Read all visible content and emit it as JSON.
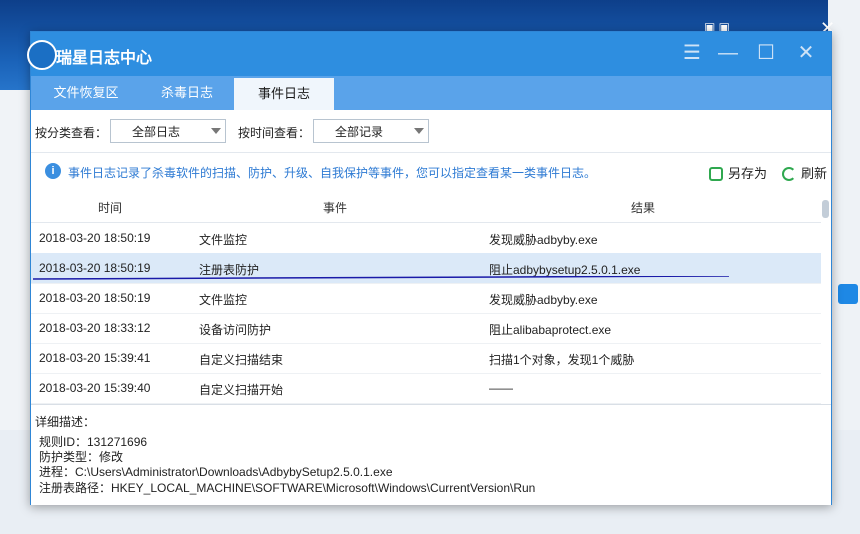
{
  "window": {
    "title": "瑞星日志中心",
    "controls": {
      "menu_icon": "menu-icon",
      "minimize_icon": "minimize-icon",
      "maximize_icon": "maximize-icon",
      "close_icon": "close-icon"
    }
  },
  "tabs": [
    {
      "label": "文件恢复区",
      "active": false
    },
    {
      "label": "杀毒日志",
      "active": false
    },
    {
      "label": "事件日志",
      "active": true
    }
  ],
  "filters": {
    "category_label": "按分类查看：",
    "category_value": "全部日志",
    "time_label": "按时间查看：",
    "time_value": "全部记录"
  },
  "info": {
    "text": "事件日志记录了杀毒软件的扫描、防护、升级、自我保护等事件，您可以指定查看某一类事件日志。",
    "save_as": "另存为",
    "refresh": "刷新"
  },
  "table": {
    "headers": [
      "时间",
      "事件",
      "结果"
    ],
    "rows": [
      {
        "time": "2018-03-20 18:50:19",
        "event": "文件监控",
        "result": "发现威胁adbyby.exe",
        "selected": false
      },
      {
        "time": "2018-03-20 18:50:19",
        "event": "注册表防护",
        "result": "阻止adbybysetup2.5.0.1.exe",
        "selected": true
      },
      {
        "time": "2018-03-20 18:50:19",
        "event": "文件监控",
        "result": "发现威胁adbyby.exe",
        "selected": false
      },
      {
        "time": "2018-03-20 18:33:12",
        "event": "设备访问防护",
        "result": "阻止alibabaprotect.exe",
        "selected": false
      },
      {
        "time": "2018-03-20 15:39:41",
        "event": "自定义扫描结束",
        "result": "扫描1个对象，发现1个威胁",
        "selected": false
      },
      {
        "time": "2018-03-20 15:39:40",
        "event": "自定义扫描开始",
        "result": "——",
        "selected": false
      }
    ]
  },
  "detail": {
    "title": "详细描述：",
    "lines": [
      "规则ID：131271696",
      "防护类型：修改",
      "进程：C:\\Users\\Administrator\\Downloads\\AdbybySetup2.5.0.1.exe",
      "注册表路径：HKEY_LOCAL_MACHINE\\SOFTWARE\\Microsoft\\Windows\\CurrentVersion\\Run"
    ]
  },
  "colors": {
    "titlebar": "#2e8ee0",
    "tabbar": "#5aa3ea",
    "info_text": "#2d7ad3",
    "selected_row": "#dbe9f8",
    "annotation_line": "#1a1aa8"
  }
}
